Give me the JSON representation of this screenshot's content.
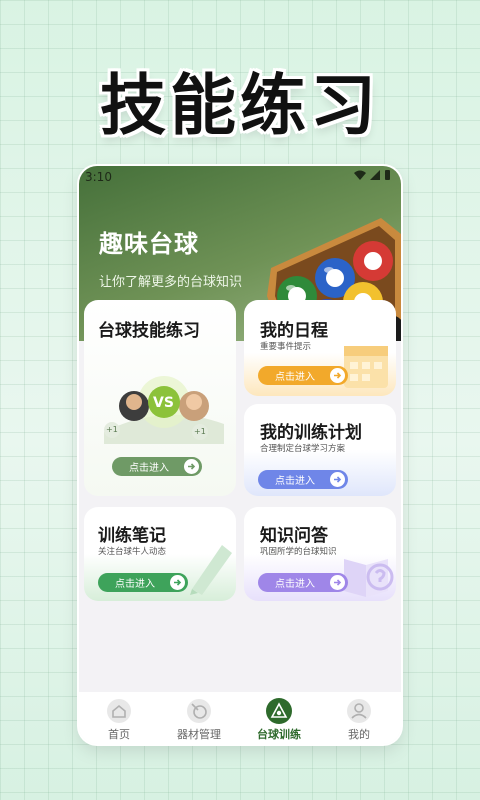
{
  "promo": {
    "title": "技能练习"
  },
  "status": {
    "time": "3:10"
  },
  "hero": {
    "title": "趣味台球",
    "subtitle": "让你了解更多的台球知识"
  },
  "cards": {
    "skill": {
      "title": "台球技能练习",
      "badge": "VS",
      "plus_left": "+1",
      "plus_right": "+1",
      "button": "点击进入"
    },
    "schedule": {
      "title": "我的日程",
      "subtitle": "重要事件提示",
      "button": "点击进入"
    },
    "plan": {
      "title": "我的训练计划",
      "subtitle": "合理制定台球学习方案",
      "button": "点击进入"
    },
    "notes": {
      "title": "训练笔记",
      "subtitle": "关注台球牛人动态",
      "button": "点击进入"
    },
    "qa": {
      "title": "知识问答",
      "subtitle": "巩固所学的台球知识",
      "button": "点击进入"
    }
  },
  "tabs": [
    {
      "label": "首页",
      "icon": "home-icon"
    },
    {
      "label": "器材管理",
      "icon": "equipment-icon"
    },
    {
      "label": "台球训练",
      "icon": "training-icon",
      "active": true
    },
    {
      "label": "我的",
      "icon": "profile-icon"
    }
  ],
  "colors": {
    "skill_accent": "#6f9a66",
    "schedule_accent": "#f2a92b",
    "plan_accent": "#6f86e8",
    "notes_accent": "#3ea35b",
    "qa_accent": "#9f86e8",
    "active_tab": "#2e6a2c"
  }
}
